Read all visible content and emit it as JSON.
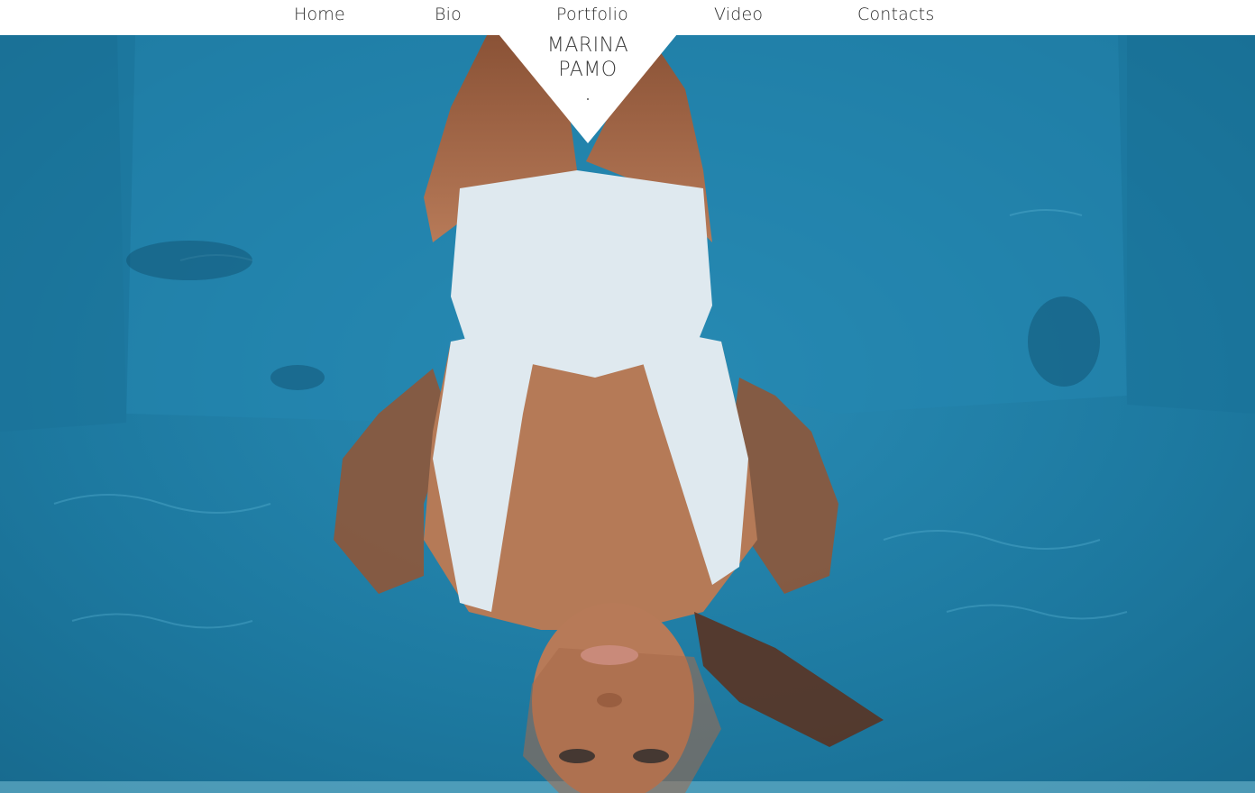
{
  "nav": {
    "items": [
      {
        "label": "Home"
      },
      {
        "label": "Bio"
      },
      {
        "label": "Portfolio"
      },
      {
        "label": "Video"
      },
      {
        "label": "Contacts"
      }
    ]
  },
  "logo": {
    "line1": "MARINA",
    "line2": "PAMO"
  },
  "hero": {
    "image": "hero-photo-woman-floating-in-pool",
    "colors": {
      "water": "#1f7fa6",
      "water_deep": "#145f82",
      "water_light": "#3a9cc2",
      "swimsuit": "#dfe9ef",
      "skin": "#a86a4a",
      "hair": "#5a3322"
    }
  }
}
